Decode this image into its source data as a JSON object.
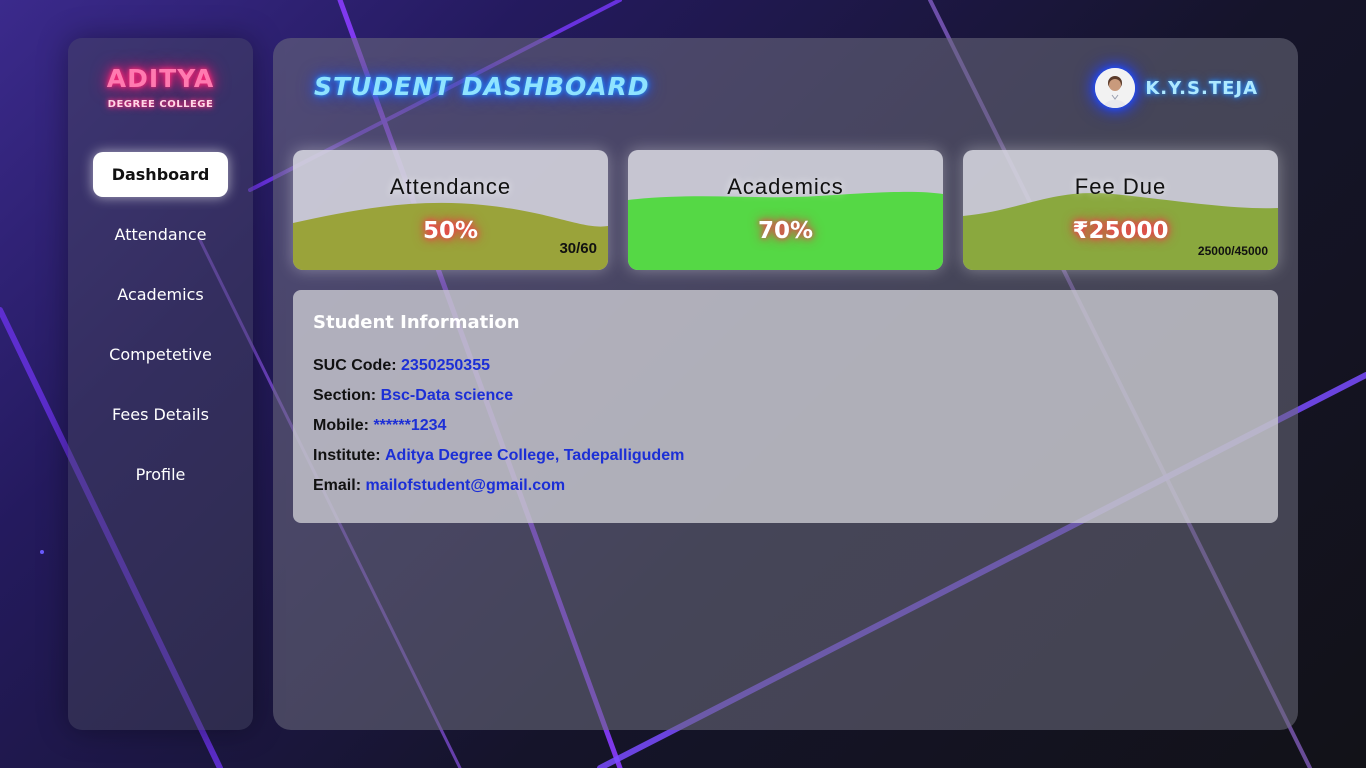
{
  "brand": {
    "name": "ADITYA",
    "subtitle": "DEGREE COLLEGE"
  },
  "sidebar": {
    "items": [
      {
        "label": "Dashboard",
        "active": true
      },
      {
        "label": "Attendance"
      },
      {
        "label": "Academics"
      },
      {
        "label": "Competetive"
      },
      {
        "label": "Fees Details"
      },
      {
        "label": "Profile"
      }
    ]
  },
  "header": {
    "title": "STUDENT DASHBOARD",
    "user_name": "K.Y.S.TEJA",
    "avatar_icon": "user-avatar"
  },
  "cards": [
    {
      "label": "Attendance",
      "value": "50%",
      "sub": "30/60",
      "fill": 0.5,
      "color": "#9aa33a"
    },
    {
      "label": "Academics",
      "value": "70%",
      "fill": 0.7,
      "color": "#55d845"
    },
    {
      "label": "Fee Due",
      "value": "₹25000",
      "sub": "25000/45000",
      "fill": 0.55,
      "color": "#8aa83e"
    }
  ],
  "info": {
    "title": "Student Information",
    "rows": [
      {
        "key": "SUC Code:",
        "value": "2350250355"
      },
      {
        "key": "Section:",
        "value": "Bsc-Data science"
      },
      {
        "key": "Mobile:",
        "value": "******1234"
      },
      {
        "key": "Institute:",
        "value": "Aditya Degree College, Tadepalligudem"
      },
      {
        "key": "Email:",
        "value": "mailofstudent@gmail.com"
      }
    ]
  },
  "colors": {
    "accent_blue": "#1c2fd6",
    "neon_pink": "#ff2a7a",
    "neon_cyan": "#8fe3ff",
    "line_purple": "#8a3cff"
  }
}
